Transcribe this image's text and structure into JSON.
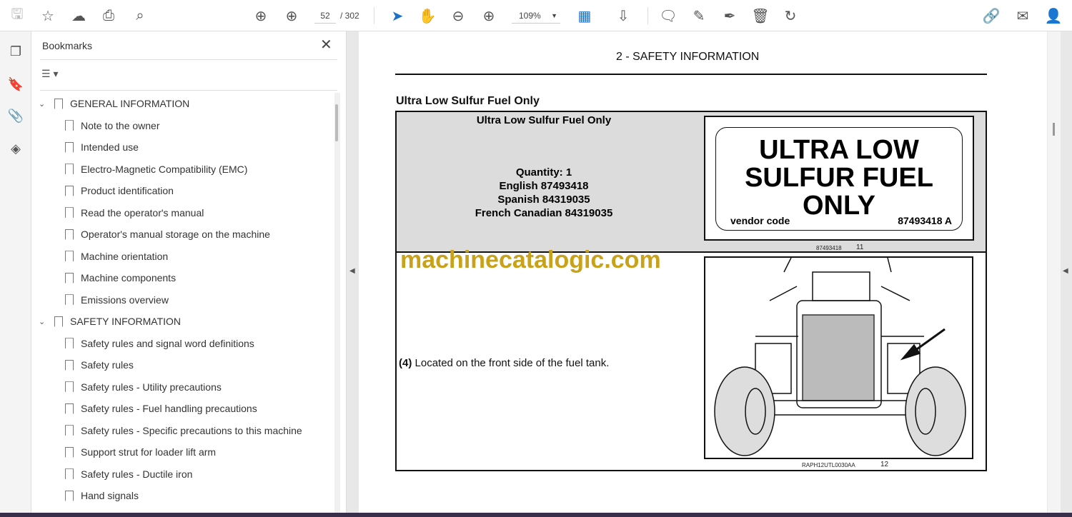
{
  "toolbar": {
    "page_current": "52",
    "page_total": "/ 302",
    "zoom": "109%",
    "icons": [
      "save-icon",
      "star-icon",
      "upload-cloud-icon",
      "print-icon",
      "search-icon",
      "page-up-icon",
      "page-down-icon",
      "select-cursor-icon",
      "hand-icon",
      "zoom-out-icon",
      "zoom-in-icon",
      "fit-page-icon",
      "scroll-mode-icon",
      "comment-icon",
      "highlight-icon",
      "sign-icon",
      "delete-icon",
      "rotate-icon",
      "share-link-icon",
      "email-icon",
      "account-icon"
    ]
  },
  "panel": {
    "title": "Bookmarks",
    "bookmarks": [
      {
        "label": "GENERAL INFORMATION",
        "level": 0
      },
      {
        "label": "Note to the owner",
        "level": 1
      },
      {
        "label": "Intended use",
        "level": 1
      },
      {
        "label": "Electro-Magnetic Compatibility (EMC)",
        "level": 1
      },
      {
        "label": "Product identification",
        "level": 1
      },
      {
        "label": "Read the operator's manual",
        "level": 1
      },
      {
        "label": "Operator's manual storage on the machine",
        "level": 1
      },
      {
        "label": "Machine orientation",
        "level": 1
      },
      {
        "label": "Machine components",
        "level": 1
      },
      {
        "label": "Emissions overview",
        "level": 1
      },
      {
        "label": "SAFETY INFORMATION",
        "level": 0
      },
      {
        "label": "Safety rules and signal word definitions",
        "level": 1
      },
      {
        "label": "Safety rules",
        "level": 1
      },
      {
        "label": "Safety rules - Utility precautions",
        "level": 1
      },
      {
        "label": "Safety rules - Fuel handling precautions",
        "level": 1
      },
      {
        "label": "Safety rules - Specific precautions to this machine",
        "level": 1
      },
      {
        "label": "Support strut for loader lift arm",
        "level": 1
      },
      {
        "label": "Safety rules - Ductile iron",
        "level": 1
      },
      {
        "label": "Hand signals",
        "level": 1
      }
    ]
  },
  "page": {
    "header": "2 - SAFETY INFORMATION",
    "section": "Ultra Low Sulfur Fuel Only",
    "decal_title": "Ultra Low Sulfur Fuel Only",
    "details": [
      "Quantity:  1",
      "English 87493418",
      "Spanish 84319035",
      "French Canadian 84319035"
    ],
    "decal_text": [
      "ULTRA LOW",
      "SULFUR FUEL",
      "ONLY"
    ],
    "vendor_label": "vendor code",
    "vendor_code": "87493418 A",
    "caption1_code": "87493418",
    "caption1_num": "11",
    "watermark": "machinecatalogic.com",
    "location_num": "(4)",
    "location_text": " Located on the front side of the fuel tank.",
    "caption2_code": "RAPH12UTL0030AA",
    "caption2_num": "12"
  }
}
